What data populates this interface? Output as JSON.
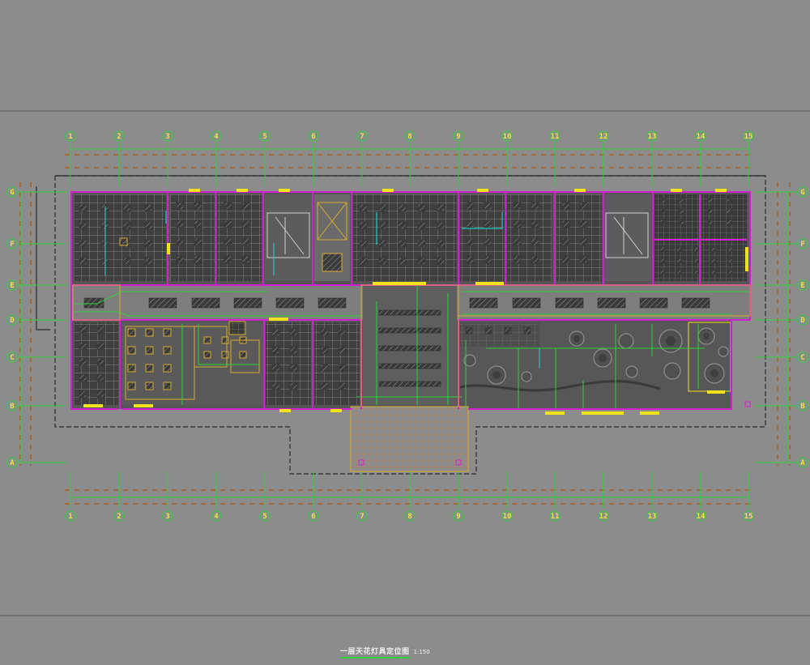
{
  "drawing": {
    "title": "一层天花灯具定位图",
    "scale": "1:150"
  },
  "grid": {
    "columns": [
      "1",
      "2",
      "3",
      "4",
      "5",
      "6",
      "7",
      "8",
      "9",
      "10",
      "11",
      "12",
      "13",
      "14",
      "15"
    ],
    "rows": [
      "G",
      "F",
      "E",
      "D",
      "C",
      "B",
      "A"
    ]
  },
  "colors": {
    "background": "#8c8c8c",
    "wall": "#d21fd2",
    "axis": "#2fd23a",
    "dim": "#a06a3a",
    "window": "#f2e21a",
    "ceiling": "#3e3e3e",
    "furniture": "#d8aa30",
    "pipe": "#22c8c8"
  }
}
